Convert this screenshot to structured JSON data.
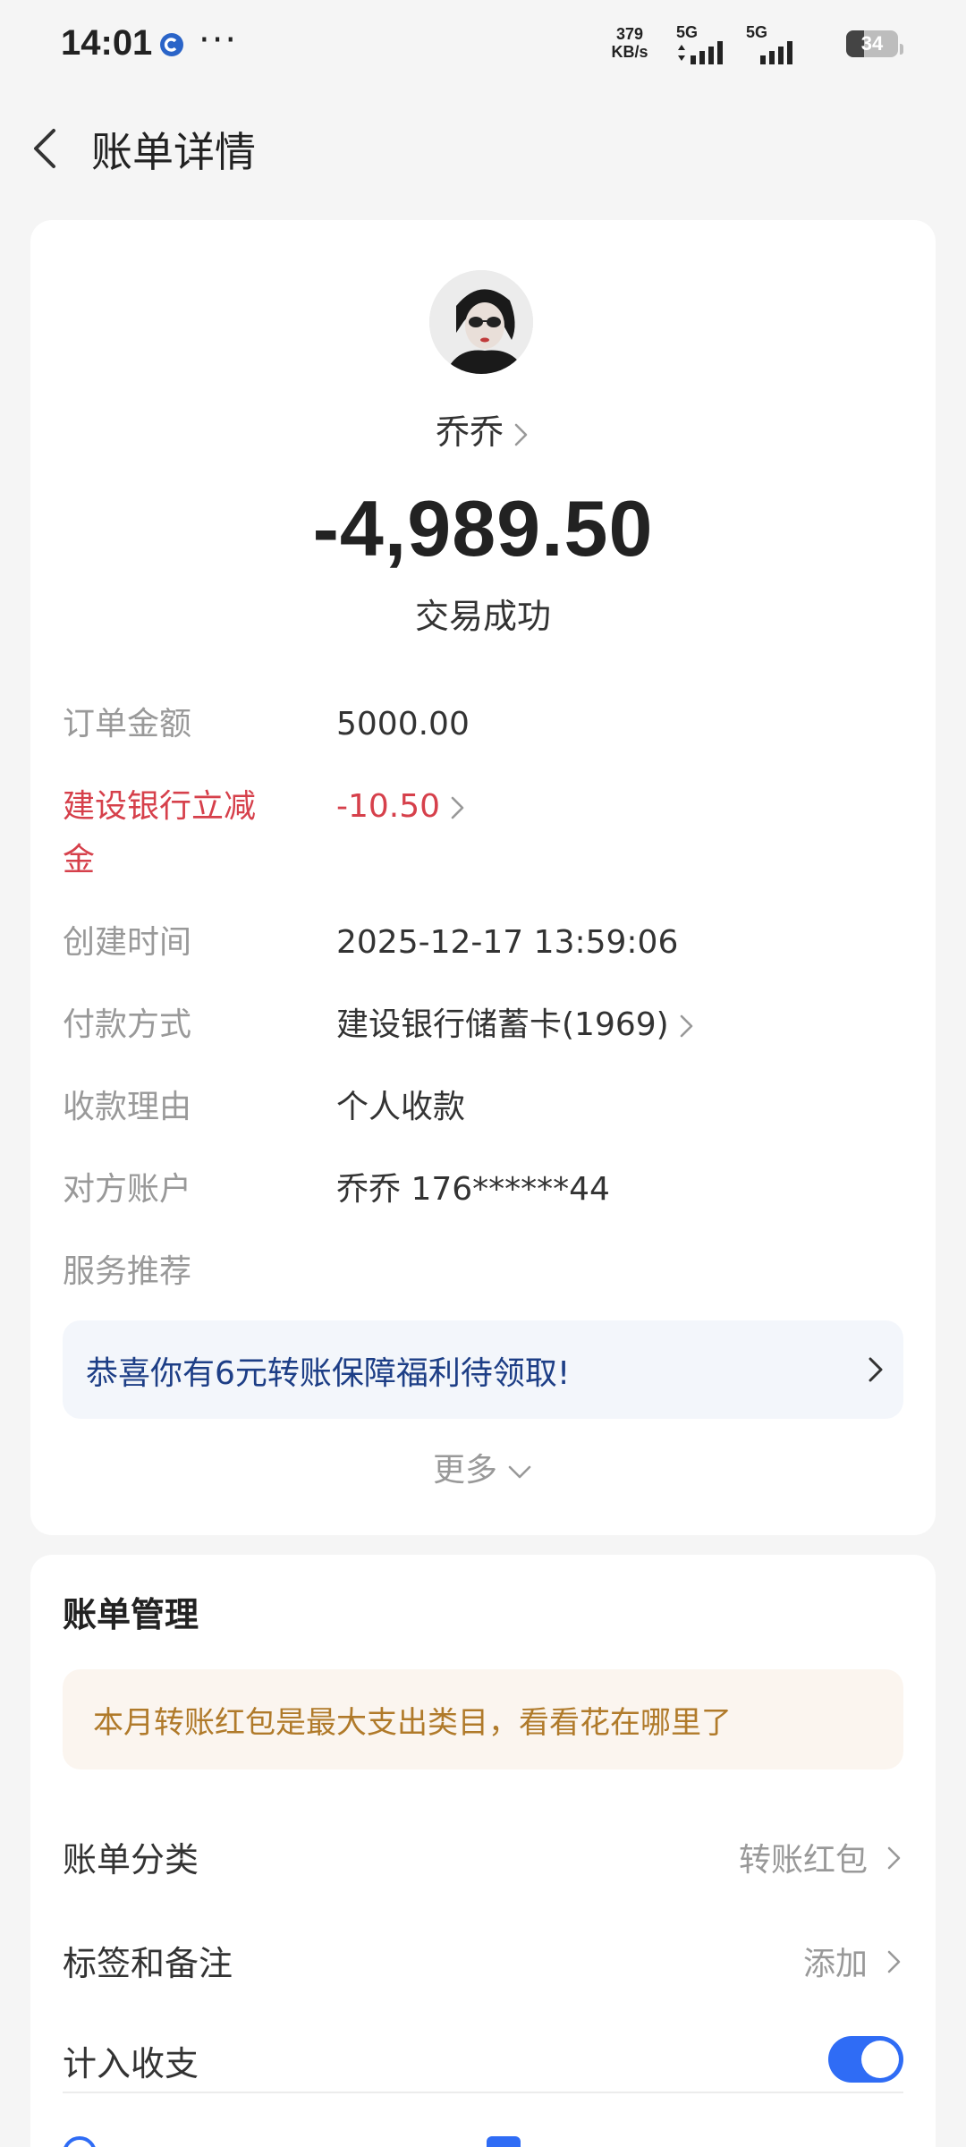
{
  "status_bar": {
    "time": "14:01",
    "net_speed_value": "379",
    "net_speed_unit": "KB/s",
    "signal_1": "5G",
    "signal_2": "5G",
    "battery": "34"
  },
  "header": {
    "title": "账单详情"
  },
  "transaction": {
    "payee": "乔乔",
    "amount": "-4,989.50",
    "status": "交易成功"
  },
  "details": [
    {
      "label": "订单金额",
      "value": "5000.00"
    },
    {
      "label": "建设银行立减金",
      "value": "-10.50"
    },
    {
      "label": "创建时间",
      "value": "2025-12-17 13:59:06"
    },
    {
      "label": "付款方式",
      "value": "建设银行储蓄卡(1969)"
    },
    {
      "label": "收款理由",
      "value": "个人收款"
    },
    {
      "label": "对方账户",
      "value": "乔乔 176******44"
    },
    {
      "label": "服务推荐",
      "value": ""
    }
  ],
  "promo": {
    "text": "恭喜你有6元转账保障福利待领取!"
  },
  "more": {
    "label": "更多"
  },
  "manage": {
    "title": "账单管理",
    "tip": "本月转账红包是最大支出类目，看看花在哪里了",
    "rows": [
      {
        "label": "账单分类",
        "value": "转账红包"
      },
      {
        "label": "标签和备注",
        "value": "添加"
      },
      {
        "label": "计入收支",
        "toggle_on": true
      }
    ]
  },
  "colors": {
    "accent": "#2f6cf5",
    "discount_red": "#d6404b",
    "promo_text": "#1d3e86",
    "tip_text": "#b07a2a"
  }
}
